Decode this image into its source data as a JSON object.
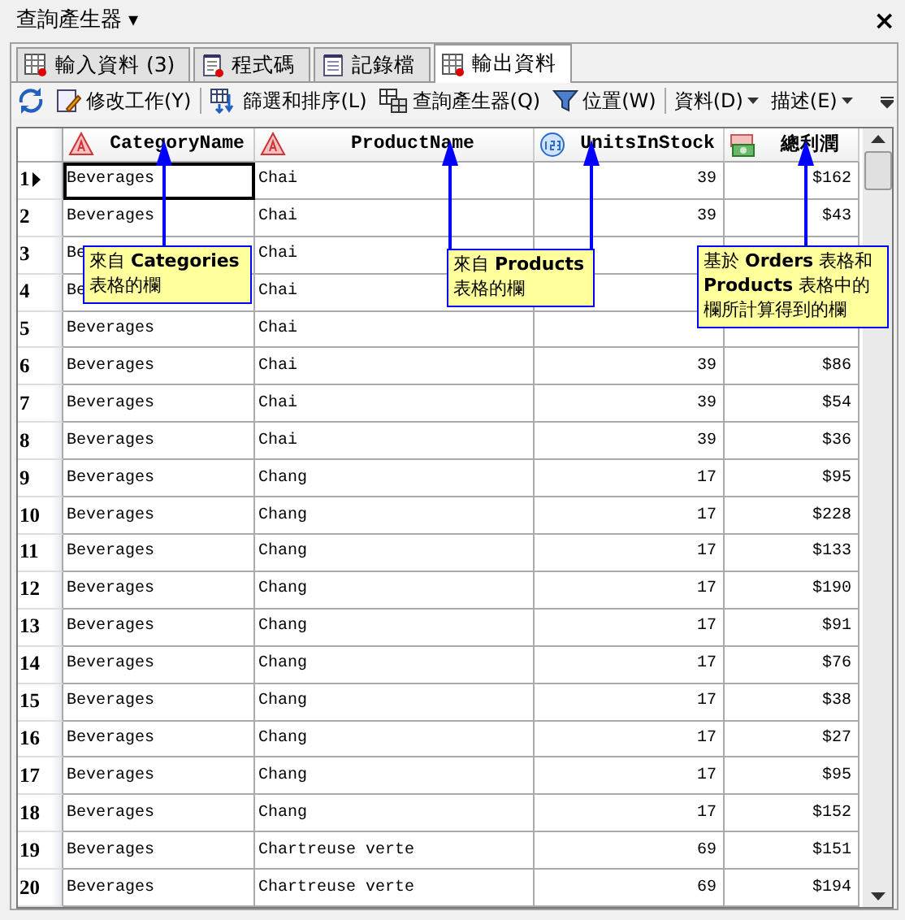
{
  "window": {
    "title": "查詢產生器",
    "menu_glyph": "▾",
    "close_glyph": "×"
  },
  "tabs": [
    {
      "label": "輸入資料  (3)",
      "selected": false
    },
    {
      "label": "程式碼",
      "selected": false
    },
    {
      "label": "記錄檔",
      "selected": false
    },
    {
      "label": "輸出資料",
      "selected": true
    }
  ],
  "toolbar": [
    {
      "kind": "button"
    },
    {
      "kind": "button",
      "label": "修改工作(Y)"
    },
    {
      "kind": "separator"
    },
    {
      "kind": "button",
      "label": "篩選和排序(L)"
    },
    {
      "kind": "button",
      "label": "查詢產生器(Q)"
    },
    {
      "kind": "button",
      "label": "位置(W)"
    },
    {
      "kind": "separator"
    },
    {
      "kind": "menu",
      "label": "資料(D)"
    },
    {
      "kind": "menu",
      "label": "描述(E)"
    }
  ],
  "table": {
    "columns": [
      {
        "label": "CategoryName",
        "kind": "text"
      },
      {
        "label": "ProductName",
        "kind": "text"
      },
      {
        "label": "UnitsInStock",
        "kind": "number"
      },
      {
        "label": "總利潤",
        "kind": "currency"
      }
    ],
    "rows": [
      {
        "number": "1",
        "selected": true,
        "cells": [
          "Beverages",
          "Chai",
          "39",
          "$162"
        ]
      },
      {
        "number": "2",
        "selected": false,
        "cells": [
          "Beverages",
          "Chai",
          "39",
          "$43"
        ]
      },
      {
        "number": "3",
        "selected": false,
        "cells": [
          "Be",
          "Chai",
          null,
          null
        ]
      },
      {
        "number": "4",
        "selected": false,
        "cells": [
          "Be",
          "Chai",
          null,
          null
        ]
      },
      {
        "number": "5",
        "selected": false,
        "cells": [
          "Beverages",
          "Chai",
          null,
          null
        ]
      },
      {
        "number": "6",
        "selected": false,
        "cells": [
          "Beverages",
          "Chai",
          "39",
          "$86"
        ]
      },
      {
        "number": "7",
        "selected": false,
        "cells": [
          "Beverages",
          "Chai",
          "39",
          "$54"
        ]
      },
      {
        "number": "8",
        "selected": false,
        "cells": [
          "Beverages",
          "Chai",
          "39",
          "$36"
        ]
      },
      {
        "number": "9",
        "selected": false,
        "cells": [
          "Beverages",
          "Chang",
          "17",
          "$95"
        ]
      },
      {
        "number": "10",
        "selected": false,
        "cells": [
          "Beverages",
          "Chang",
          "17",
          "$228"
        ]
      },
      {
        "number": "11",
        "selected": false,
        "cells": [
          "Beverages",
          "Chang",
          "17",
          "$133"
        ]
      },
      {
        "number": "12",
        "selected": false,
        "cells": [
          "Beverages",
          "Chang",
          "17",
          "$190"
        ]
      },
      {
        "number": "13",
        "selected": false,
        "cells": [
          "Beverages",
          "Chang",
          "17",
          "$91"
        ]
      },
      {
        "number": "14",
        "selected": false,
        "cells": [
          "Beverages",
          "Chang",
          "17",
          "$76"
        ]
      },
      {
        "number": "15",
        "selected": false,
        "cells": [
          "Beverages",
          "Chang",
          "17",
          "$38"
        ]
      },
      {
        "number": "16",
        "selected": false,
        "cells": [
          "Beverages",
          "Chang",
          "17",
          "$27"
        ]
      },
      {
        "number": "17",
        "selected": false,
        "cells": [
          "Beverages",
          "Chang",
          "17",
          "$95"
        ]
      },
      {
        "number": "18",
        "selected": false,
        "cells": [
          "Beverages",
          "Chang",
          "17",
          "$152"
        ]
      },
      {
        "number": "19",
        "selected": false,
        "cells": [
          "Beverages",
          "Chartreuse verte",
          "69",
          "$151"
        ]
      },
      {
        "number": "20",
        "selected": false,
        "cells": [
          "Beverages",
          "Chartreuse verte",
          "69",
          "$194"
        ]
      }
    ]
  },
  "callouts": [
    {
      "lines": [
        "來自 **Categories**",
        "表格的欄"
      ]
    },
    {
      "lines": [
        "來自 **Products**",
        "表格的欄"
      ]
    },
    {
      "lines": [
        "基於 **Orders** 表格和",
        "**Products** 表格中的",
        "欄所計算得到的欄"
      ]
    }
  ]
}
